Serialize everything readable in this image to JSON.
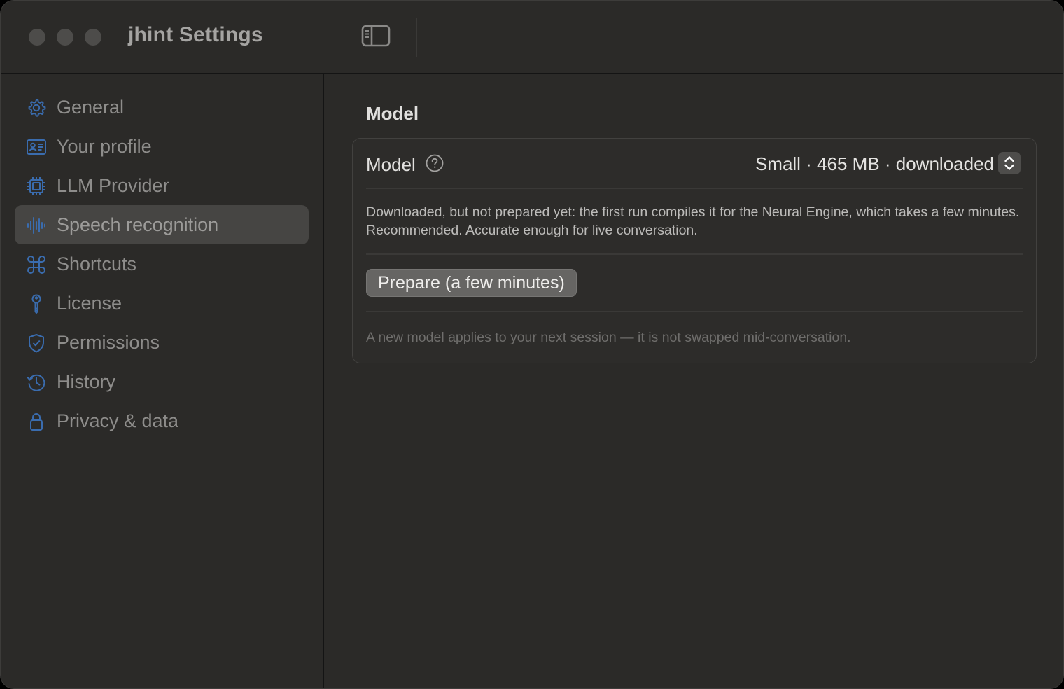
{
  "window": {
    "title": "jhint Settings"
  },
  "sidebar": {
    "items": [
      {
        "label": "General",
        "icon": "gear-icon",
        "selected": false
      },
      {
        "label": "Your profile",
        "icon": "id-card-icon",
        "selected": false
      },
      {
        "label": "LLM Provider",
        "icon": "chip-icon",
        "selected": false
      },
      {
        "label": "Speech recognition",
        "icon": "waveform-icon",
        "selected": true
      },
      {
        "label": "Shortcuts",
        "icon": "command-icon",
        "selected": false
      },
      {
        "label": "License",
        "icon": "key-icon",
        "selected": false
      },
      {
        "label": "Permissions",
        "icon": "shield-check-icon",
        "selected": false
      },
      {
        "label": "History",
        "icon": "history-clock-icon",
        "selected": false
      },
      {
        "label": "Privacy & data",
        "icon": "lock-icon",
        "selected": false
      }
    ]
  },
  "main": {
    "section_title": "Model",
    "model_row": {
      "label": "Model",
      "selected_value": "Small · 465 MB · downloaded"
    },
    "description": "Downloaded, but not prepared yet: the first run compiles it for the Neural Engine, which takes a few minutes. Recommended. Accurate enough for live conversation.",
    "prepare_button_label": "Prepare (a few minutes)",
    "note": "A new model applies to your next session — it is not swapped mid-conversation."
  },
  "colors": {
    "window_bg": "#2b2a28",
    "sidebar_selected_bg": "#464543",
    "sidebar_icon": "#3c6fb0",
    "button_bg": "#666563"
  }
}
